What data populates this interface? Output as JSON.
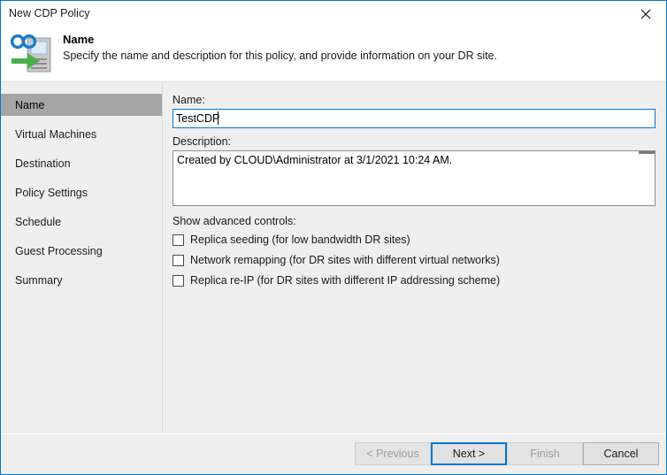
{
  "window": {
    "title": "New CDP Policy",
    "close_icon": "close-icon",
    "accent_color": "#0078d7",
    "body_bg": "#efefef",
    "selected_nav_bg": "#a6a6a6"
  },
  "header": {
    "icon": "cdp-policy-icon",
    "title": "Name",
    "subtitle": "Specify the name and description for this policy, and provide information on your DR site."
  },
  "sidebar": {
    "items": [
      {
        "label": "Name",
        "selected": true
      },
      {
        "label": "Virtual Machines",
        "selected": false
      },
      {
        "label": "Destination",
        "selected": false
      },
      {
        "label": "Policy Settings",
        "selected": false
      },
      {
        "label": "Schedule",
        "selected": false
      },
      {
        "label": "Guest Processing",
        "selected": false
      },
      {
        "label": "Summary",
        "selected": false
      }
    ]
  },
  "main": {
    "name_label": "Name:",
    "name_value": "TestCDP",
    "name_placeholder": "",
    "description_label": "Description:",
    "description_value": "Created by CLOUD\\Administrator at 3/1/2021 10:24 AM.",
    "description_placeholder": "",
    "advanced_label": "Show advanced controls:",
    "checkboxes": [
      {
        "label": "Replica seeding (for low bandwidth DR sites)",
        "checked": false
      },
      {
        "label": "Network remapping (for DR sites with different virtual networks)",
        "checked": false
      },
      {
        "label": "Replica re-IP (for DR sites with different IP addressing scheme)",
        "checked": false
      }
    ]
  },
  "footer": {
    "buttons": [
      {
        "label": "< Previous",
        "state": "disabled"
      },
      {
        "label": "Next >",
        "state": "default"
      },
      {
        "label": "Finish",
        "state": "disabled"
      },
      {
        "label": "Cancel",
        "state": "normal"
      }
    ]
  }
}
